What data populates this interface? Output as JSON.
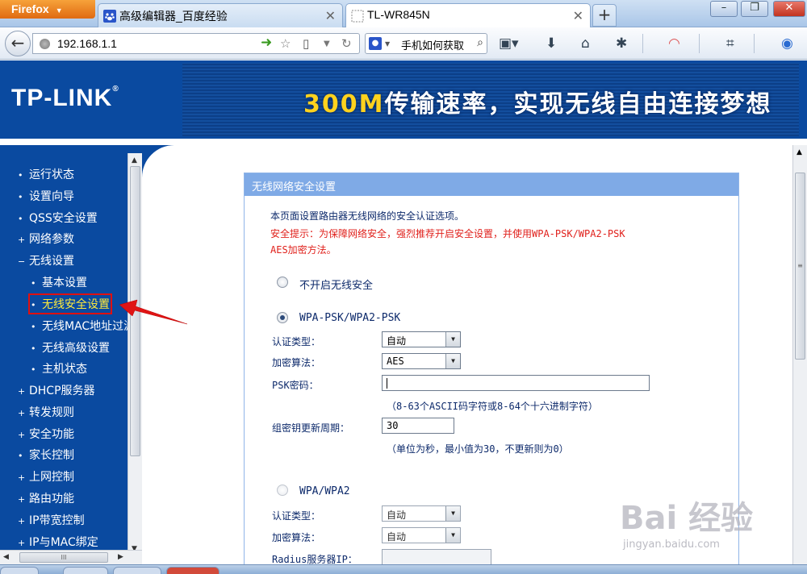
{
  "browser": {
    "menu_button": "Firefox",
    "tabs": [
      {
        "label": "高级编辑器_百度经验"
      },
      {
        "label": "TL-WR845N"
      }
    ],
    "new_tab": "+",
    "window": {
      "minimize": "–",
      "maximize": "❐",
      "close": "✕"
    },
    "url": "192.168.1.1",
    "search": {
      "text": "手机如何获取"
    }
  },
  "header": {
    "logo": "TP-LINK",
    "logo_reg": "®",
    "banner_highlight": "300M",
    "banner_text": "传输速率，实现无线自由连接梦想"
  },
  "sidebar": {
    "items": [
      {
        "label": "运行状态",
        "bullet": "•"
      },
      {
        "label": "设置向导",
        "bullet": "•"
      },
      {
        "label": "QSS安全设置",
        "bullet": "•"
      },
      {
        "label": "网络参数",
        "bullet": "+"
      },
      {
        "label": "无线设置",
        "bullet": "−"
      },
      {
        "label": "基本设置",
        "bullet": "•"
      },
      {
        "label": "无线安全设置",
        "bullet": "•"
      },
      {
        "label": "无线MAC地址过滤",
        "bullet": "•"
      },
      {
        "label": "无线高级设置",
        "bullet": "•"
      },
      {
        "label": "主机状态",
        "bullet": "•"
      },
      {
        "label": "DHCP服务器",
        "bullet": "+"
      },
      {
        "label": "转发规则",
        "bullet": "+"
      },
      {
        "label": "安全功能",
        "bullet": "+"
      },
      {
        "label": "家长控制",
        "bullet": "•"
      },
      {
        "label": "上网控制",
        "bullet": "+"
      },
      {
        "label": "路由功能",
        "bullet": "+"
      },
      {
        "label": "IP带宽控制",
        "bullet": "+"
      },
      {
        "label": "IP与MAC绑定",
        "bullet": "+"
      }
    ],
    "hscroll_grip": "III"
  },
  "panel": {
    "title": "无线网络安全设置",
    "intro": "本页面设置路由器无线网络的安全认证选项。",
    "warning_line1": "安全提示：为保障网络安全，强烈推荐开启安全设置，并使用WPA-PSK/WPA2-PSK",
    "warning_line2": "AES加密方法。",
    "option_none": "不开启无线安全",
    "option_psk": "WPA-PSK/WPA2-PSK",
    "psk": {
      "auth_label": "认证类型：",
      "auth_value": "自动",
      "enc_label": "加密算法：",
      "enc_value": "AES",
      "key_label": "PSK密码：",
      "key_value": "",
      "key_hint": "（8-63个ASCII码字符或8-64个十六进制字符）",
      "renew_label": "组密钥更新周期：",
      "renew_value": "30",
      "renew_hint": "（单位为秒，最小值为30，不更新则为0）"
    },
    "option_wpa": "WPA/WPA2",
    "wpa": {
      "auth_label": "认证类型：",
      "auth_value": "自动",
      "enc_label": "加密算法：",
      "enc_value": "自动",
      "radius_label": "Radius服务器IP："
    }
  },
  "watermark": {
    "logo": "Bai 经验",
    "url": "jingyan.baidu.com"
  },
  "colors": {
    "router_blue": "#0a4aa0",
    "panel_header": "#7faae6",
    "warning_red": "#e0211c",
    "firefox_orange": "#e06a12"
  }
}
